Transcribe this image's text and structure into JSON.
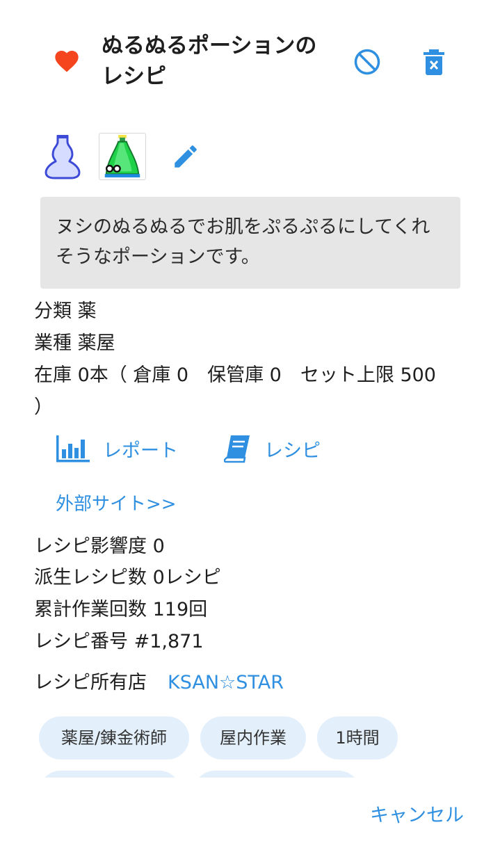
{
  "header": {
    "title": "ぬるぬるポーションのレシピ",
    "icons": [
      "heart-icon",
      "ban-icon",
      "trash-icon"
    ]
  },
  "images": {
    "icons": [
      "flask-icon",
      "potion-image",
      "pencil-icon"
    ]
  },
  "description": "ヌシのぬるぬるでお肌をぷるぷるにしてくれそうなポーションです。",
  "info": {
    "category": "分類 薬",
    "industry": "業種 薬屋",
    "stock": "在庫 0本（ 倉庫 0　保管庫 0　セット上限 500 ）"
  },
  "links": {
    "report": "レポート",
    "recipe": "レシピ",
    "external": "外部サイト>>"
  },
  "stats": {
    "influence": "レシピ影響度 0",
    "derived": "派生レシピ数 0レシピ",
    "work_count": "累計作業回数 119回",
    "number": "レシピ番号 #1,871"
  },
  "owner": {
    "label": "レシピ所有店",
    "shop": "KSAN☆STAR"
  },
  "tags": [
    "薬屋/錬金術師",
    "屋内作業",
    "1時間"
  ],
  "footer": {
    "cancel": "キャンセル"
  },
  "colors": {
    "accent": "#2f8fe0",
    "heart": "#f4451f",
    "tag_bg": "#e3f0fc",
    "desc_bg": "#e6e6e6"
  }
}
